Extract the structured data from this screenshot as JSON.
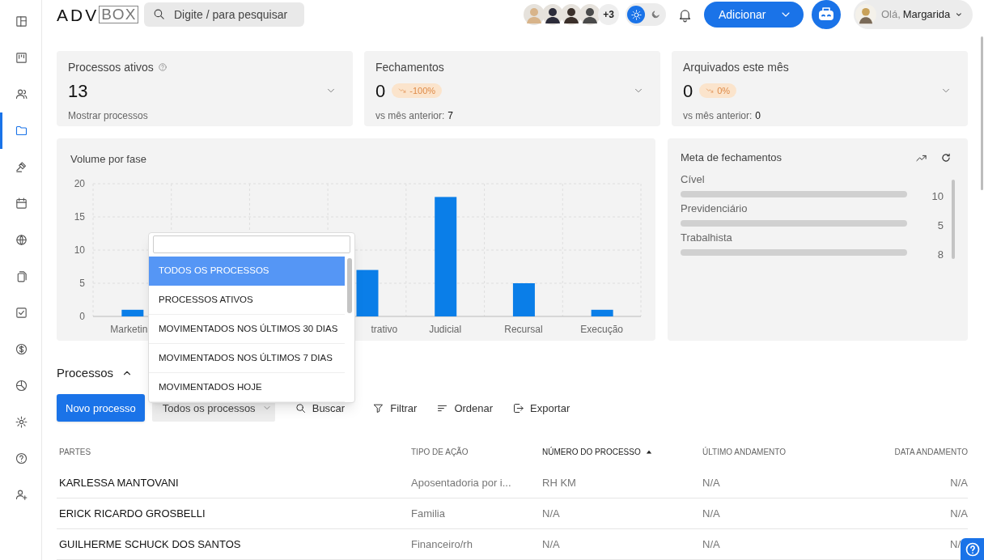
{
  "logo": {
    "text_1": "ADV",
    "text_2": "BOX"
  },
  "search": {
    "placeholder": "Digite / para pesquisar"
  },
  "team": {
    "more": "+3"
  },
  "theme_toggle": [
    {
      "kind": "light",
      "selected": true
    },
    {
      "kind": "dark",
      "selected": false
    }
  ],
  "add_button": "Adicionar",
  "user": {
    "greeting": "Olá,",
    "name": "Margarida"
  },
  "sidebar": {
    "items": [
      {
        "kind": "layout",
        "selected": false
      },
      {
        "kind": "kanban",
        "selected": false
      },
      {
        "kind": "users",
        "selected": false
      },
      {
        "kind": "folder",
        "selected": true
      },
      {
        "kind": "gavel",
        "selected": false
      },
      {
        "kind": "calendar",
        "selected": false
      },
      {
        "kind": "globe",
        "selected": false
      },
      {
        "kind": "documents",
        "selected": false
      },
      {
        "kind": "checkbox",
        "selected": false
      },
      {
        "kind": "dollar",
        "selected": false
      },
      {
        "kind": "pie",
        "selected": false
      },
      {
        "kind": "settings",
        "selected": false
      },
      {
        "kind": "help",
        "selected": false
      },
      {
        "kind": "user-plus",
        "selected": false
      }
    ]
  },
  "stats": [
    {
      "kind": "link",
      "title": "Processos ativos",
      "value": "13",
      "footer": "Mostrar processos"
    },
    {
      "kind": "comparison",
      "title": "Fechamentos",
      "value": "0",
      "badge": "-100%",
      "footer": "vs mês anterior:",
      "footer_value": "7"
    },
    {
      "kind": "comparison",
      "title": "Arquivados este mês",
      "value": "0",
      "badge": "0%",
      "footer": "vs mês anterior:",
      "footer_value": "0"
    }
  ],
  "volume_chart": {
    "title": "Volume por fase",
    "chart_data": {
      "type": "bar",
      "categories": [
        "Marketin",
        null,
        null,
        "trativo",
        "Judicial",
        "Recursal",
        "Execução"
      ],
      "values": [
        1,
        null,
        null,
        7,
        18,
        5,
        1
      ],
      "grid": true,
      "ylim": [
        0,
        20
      ],
      "yticks": [
        0,
        5,
        10,
        15,
        20
      ]
    }
  },
  "goals": {
    "title": "Meta de fechamentos",
    "items": [
      {
        "label": "Cível",
        "level": 0,
        "value": "10"
      },
      {
        "label": "Previdenciário",
        "level": 0,
        "value": "5"
      },
      {
        "label": "Trabalhista",
        "level": 0,
        "value": "8"
      }
    ]
  },
  "processes": {
    "title": "Processos",
    "expanded": true,
    "new_button": "Novo processo",
    "filter_select": "Todos os processos",
    "actions": [
      {
        "kind": "search",
        "label": "Buscar"
      },
      {
        "kind": "filter",
        "label": "Filtrar"
      },
      {
        "kind": "sort",
        "label": "Ordenar"
      },
      {
        "kind": "export",
        "label": "Exportar"
      }
    ],
    "table": {
      "columns": [
        {
          "label": "PARTES",
          "sorted": false
        },
        {
          "label": "TIPO DE AÇÃO",
          "sorted": false
        },
        {
          "label": "NÚMERO DO PROCESSO",
          "sorted": true
        },
        {
          "label": "ÚLTIMO ANDAMENTO",
          "sorted": false
        },
        {
          "label": "DATA ANDAMENTO",
          "sorted": false
        }
      ],
      "rows": [
        [
          "KARLESSA MANTOVANI",
          "Aposentadoria por i...",
          "RH KM",
          "N/A",
          "N/A"
        ],
        [
          "ERICK RICARDO GROSBELLI",
          "Familia",
          "N/A",
          "N/A",
          "N/A"
        ],
        [
          "GUILHERME SCHUCK DOS SANTOS",
          "Financeiro/rh",
          "N/A",
          "N/A",
          "N/"
        ]
      ]
    }
  },
  "filter_dropdown": {
    "options": [
      {
        "label": "TODOS OS PROCESSOS",
        "selected": true
      },
      {
        "label": "PROCESSOS ATIVOS",
        "selected": false
      },
      {
        "label": "MOVIMENTADOS NOS ÚLTIMOS 30 DIAS",
        "selected": false
      },
      {
        "label": "MOVIMENTADOS NOS ÚLTIMOS 7 DIAS",
        "selected": false
      },
      {
        "label": "MOVIMENTADOS HOJE",
        "selected": false
      }
    ]
  }
}
